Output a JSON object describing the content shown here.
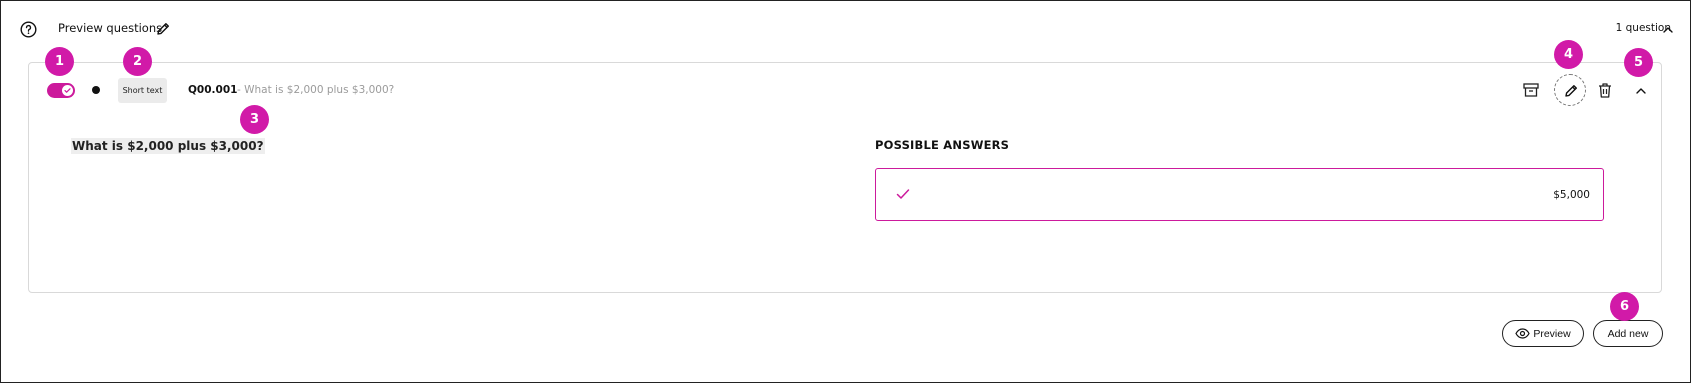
{
  "header": {
    "title": "Preview questions",
    "count": "1 question",
    "icons": {
      "help": "help-circle-icon",
      "edit": "pencil-icon",
      "collapse": "chevron-up-icon"
    }
  },
  "question": {
    "enabled": true,
    "type_label": "Short text",
    "code": "Q00.001",
    "subtitle": "- What is $2,000 plus $3,000?",
    "text": "What is $2,000 plus $3,000?",
    "possible_answers_header": "POSSIBLE ANSWERS",
    "answers": [
      {
        "value": "$5,000",
        "correct": true
      }
    ],
    "actions": [
      "archive-icon",
      "pencil-icon",
      "trash-icon",
      "chevron-up-icon"
    ]
  },
  "footer": {
    "preview_label": "Preview",
    "add_new_label": "Add new"
  },
  "badges": [
    "1",
    "2",
    "3",
    "4",
    "5",
    "6"
  ],
  "colors": {
    "accent": "#cc1a9c",
    "badge": "#d11aa8",
    "chip_bg": "#ebebeb",
    "muted_text": "#9b9b9b"
  }
}
